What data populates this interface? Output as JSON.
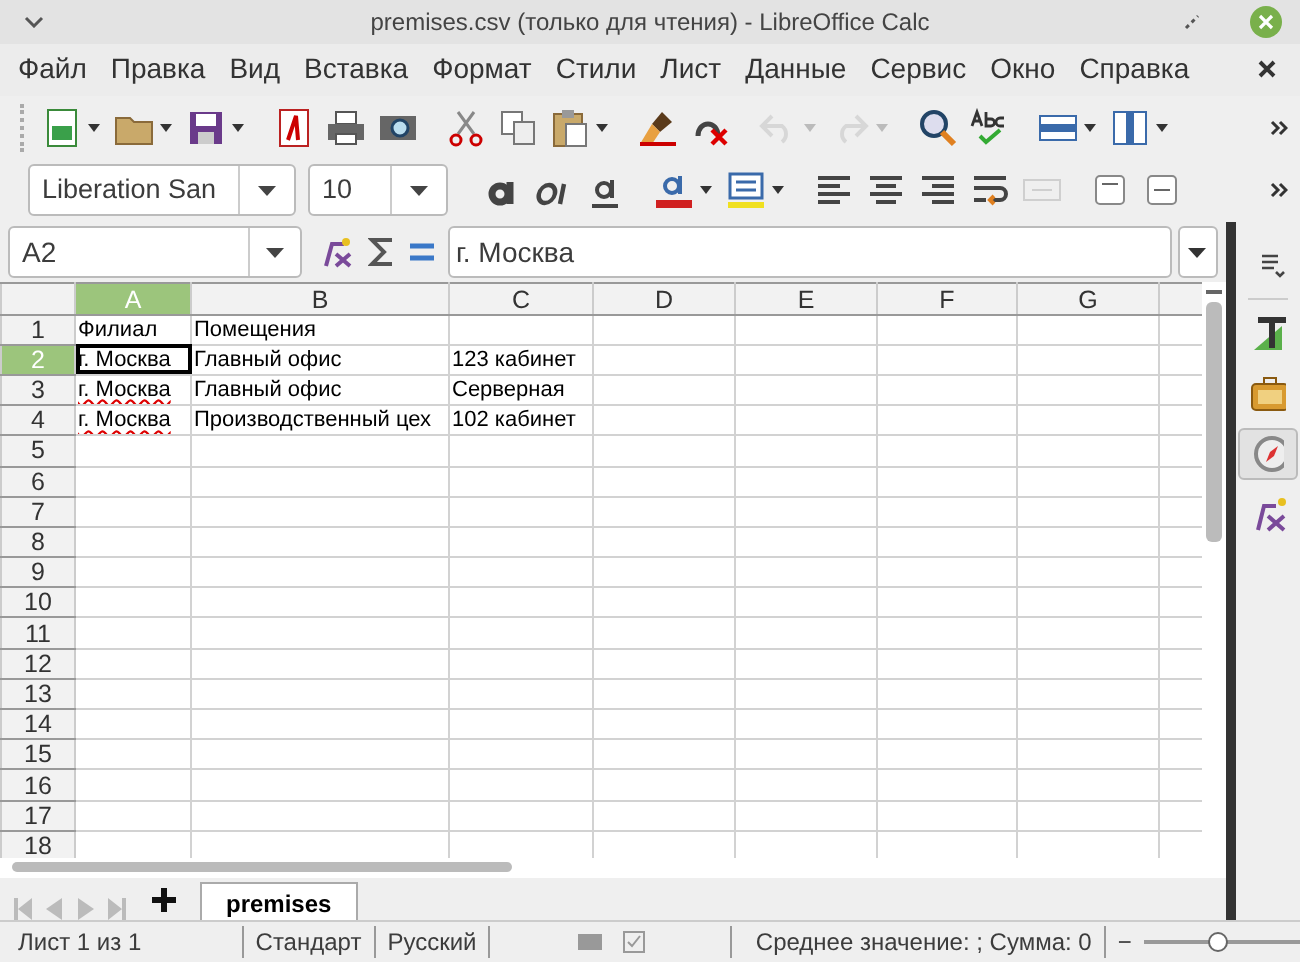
{
  "window": {
    "title": "premises.csv (только для чтения) - LibreOffice Calc"
  },
  "menu": [
    "Файл",
    "Правка",
    "Вид",
    "Вставка",
    "Формат",
    "Стили",
    "Лист",
    "Данные",
    "Сервис",
    "Окно",
    "Справка"
  ],
  "toolbar_1": [
    {
      "kind": "new",
      "dropdown": true,
      "disabled": false
    },
    {
      "kind": "open",
      "dropdown": true,
      "disabled": false
    },
    {
      "kind": "save",
      "dropdown": true,
      "disabled": false
    },
    {
      "kind": "pdf",
      "dropdown": false,
      "disabled": false
    },
    {
      "kind": "print",
      "dropdown": false,
      "disabled": false
    },
    {
      "kind": "preview",
      "dropdown": false,
      "disabled": false
    },
    {
      "kind": "cut",
      "dropdown": false,
      "disabled": false
    },
    {
      "kind": "copy",
      "dropdown": false,
      "disabled": false
    },
    {
      "kind": "paste",
      "dropdown": true,
      "disabled": false
    },
    {
      "kind": "brush",
      "dropdown": false,
      "disabled": false
    },
    {
      "kind": "clear",
      "dropdown": false,
      "disabled": false
    },
    {
      "kind": "undo",
      "dropdown": true,
      "disabled": true
    },
    {
      "kind": "redo",
      "dropdown": true,
      "disabled": true
    },
    {
      "kind": "find",
      "dropdown": false,
      "disabled": false
    },
    {
      "kind": "spell",
      "dropdown": false,
      "disabled": false
    },
    {
      "kind": "rows",
      "dropdown": true,
      "disabled": false
    },
    {
      "kind": "cols",
      "dropdown": true,
      "disabled": false
    }
  ],
  "font_name": "Liberation San",
  "font_size": "10",
  "toolbar_2": [
    {
      "kind": "bold",
      "dropdown": false,
      "disabled": false
    },
    {
      "kind": "italic",
      "dropdown": false,
      "disabled": false
    },
    {
      "kind": "underline",
      "dropdown": false,
      "disabled": false
    },
    {
      "kind": "fontcolor",
      "dropdown": true,
      "disabled": false
    },
    {
      "kind": "highlight",
      "dropdown": true,
      "disabled": false
    },
    {
      "kind": "left",
      "dropdown": false,
      "disabled": false
    },
    {
      "kind": "center",
      "dropdown": false,
      "disabled": false
    },
    {
      "kind": "right",
      "dropdown": false,
      "disabled": false
    },
    {
      "kind": "wrap",
      "dropdown": false,
      "disabled": false
    },
    {
      "kind": "merge",
      "dropdown": false,
      "disabled": true
    },
    {
      "kind": "top",
      "dropdown": false,
      "disabled": false
    },
    {
      "kind": "middle",
      "dropdown": false,
      "disabled": false
    }
  ],
  "name_box": "A2",
  "formula": "г. Москва",
  "columns": [
    {
      "label": "A",
      "selected": true
    },
    {
      "label": "B",
      "selected": false
    },
    {
      "label": "C",
      "selected": false
    },
    {
      "label": "D",
      "selected": false
    },
    {
      "label": "E",
      "selected": false
    },
    {
      "label": "F",
      "selected": false
    },
    {
      "label": "G",
      "selected": false
    }
  ],
  "rows": [
    {
      "number": "1",
      "selected": false,
      "cells": [
        {
          "text": "Филиал",
          "active": false,
          "spell_error": false
        },
        {
          "text": "Помещения",
          "active": false,
          "spell_error": false
        }
      ]
    },
    {
      "number": "2",
      "selected": true,
      "cells": [
        {
          "text": "г. Москва",
          "active": true,
          "spell_error": false
        },
        {
          "text": "Главный офис",
          "active": false,
          "spell_error": false
        },
        {
          "text": "123 кабинет",
          "active": false,
          "spell_error": false
        }
      ]
    },
    {
      "number": "3",
      "selected": false,
      "cells": [
        {
          "text": "г. Москва",
          "active": false,
          "spell_error": true
        },
        {
          "text": "Главный офис",
          "active": false,
          "spell_error": false
        },
        {
          "text": "Серверная",
          "active": false,
          "spell_error": false
        }
      ]
    },
    {
      "number": "4",
      "selected": false,
      "cells": [
        {
          "text": "г. Москва",
          "active": false,
          "spell_error": true
        },
        {
          "text": "Производственный цех",
          "active": false,
          "spell_error": false
        },
        {
          "text": "102 кабинет",
          "active": false,
          "spell_error": false
        }
      ]
    },
    {
      "number": "5",
      "selected": false,
      "cells": []
    },
    {
      "number": "6",
      "selected": false,
      "cells": []
    },
    {
      "number": "7",
      "selected": false,
      "cells": []
    },
    {
      "number": "8",
      "selected": false,
      "cells": []
    },
    {
      "number": "9",
      "selected": false,
      "cells": []
    },
    {
      "number": "10",
      "selected": false,
      "cells": []
    },
    {
      "number": "11",
      "selected": false,
      "cells": []
    },
    {
      "number": "12",
      "selected": false,
      "cells": []
    },
    {
      "number": "13",
      "selected": false,
      "cells": []
    },
    {
      "number": "14",
      "selected": false,
      "cells": []
    },
    {
      "number": "15",
      "selected": false,
      "cells": []
    },
    {
      "number": "16",
      "selected": false,
      "cells": []
    },
    {
      "number": "17",
      "selected": false,
      "cells": []
    },
    {
      "number": "18",
      "selected": false,
      "cells": []
    }
  ],
  "sidebar": [
    {
      "kind": "properties",
      "selected": false
    },
    {
      "kind": "styles",
      "selected": false
    },
    {
      "kind": "gallery",
      "selected": false
    },
    {
      "kind": "navigator",
      "selected": true
    },
    {
      "kind": "functions",
      "selected": false
    }
  ],
  "sheet_tabs": [
    {
      "label": "premises",
      "selected": true
    }
  ],
  "status_bar": {
    "sheet": "Лист 1 из 1",
    "page_style": "Стандарт",
    "language": "Русский",
    "summary": "Среднее значение: ; Сумма: 0",
    "zoom_minus": "−",
    "zoom_slider": {
      "level": 0.48
    }
  }
}
